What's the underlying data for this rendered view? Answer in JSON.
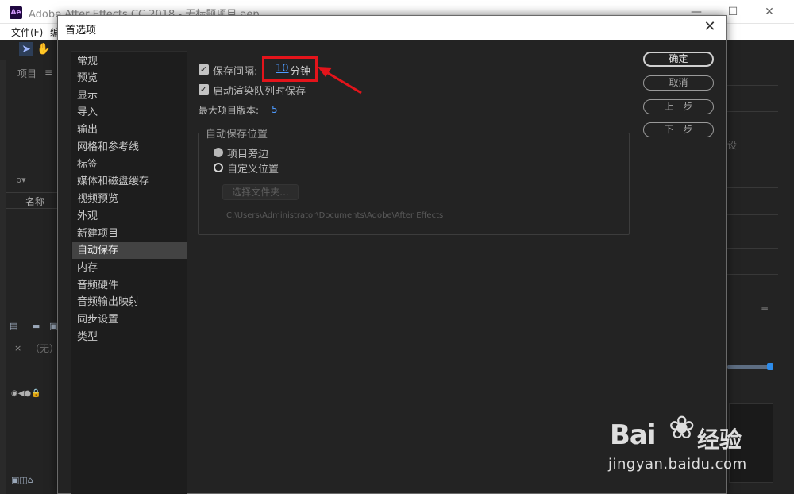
{
  "app": {
    "logo_text": "Ae",
    "title": "Adobe After Effects CC 2018 - 无标题项目.aep",
    "window_controls": {
      "minimize": "—",
      "maximize": "☐",
      "close": "✕"
    },
    "menu": [
      "文件(F)",
      "编"
    ]
  },
  "left_panel": {
    "project_label": "项目",
    "menu_icon": "≡",
    "search_icon": "ρ▾",
    "name_header": "名称",
    "comp_none": "（无）",
    "close": "×"
  },
  "right_panel": {
    "partial_label": "设",
    "menu_icon": "≡"
  },
  "dialog": {
    "title": "首选项",
    "close": "✕",
    "nav": [
      "常规",
      "预览",
      "显示",
      "导入",
      "输出",
      "网格和参考线",
      "标签",
      "媒体和磁盘缓存",
      "视频预览",
      "外观",
      "新建项目",
      "自动保存",
      "内存",
      "音频硬件",
      "音频输出映射",
      "同步设置",
      "类型"
    ],
    "nav_selected_index": 11,
    "save_interval_label": "保存间隔:",
    "save_interval_value": "10",
    "save_interval_unit": "分钟",
    "save_on_render_label": "启动渲染队列时保存",
    "max_versions_label": "最大项目版本:",
    "max_versions_value": "5",
    "location_group_title": "自动保存位置",
    "radio_next_to_project": "项目旁边",
    "radio_custom_location": "自定义位置",
    "choose_folder_label": "选择文件夹...",
    "folder_path": "C:\\Users\\Administrator\\Documents\\Adobe\\After Effects",
    "buttons": {
      "ok": "确定",
      "cancel": "取消",
      "prev": "上一步",
      "next": "下一步"
    },
    "checkbox_mark": "✓"
  },
  "watermark": {
    "brand": "Bai",
    "paw": "❀",
    "chinese": "经验",
    "url": "jingyan.baidu.com"
  },
  "colors": {
    "accent_blue": "#4e9bff",
    "highlight_red": "#e4141b",
    "dialog_bg": "#232323"
  }
}
